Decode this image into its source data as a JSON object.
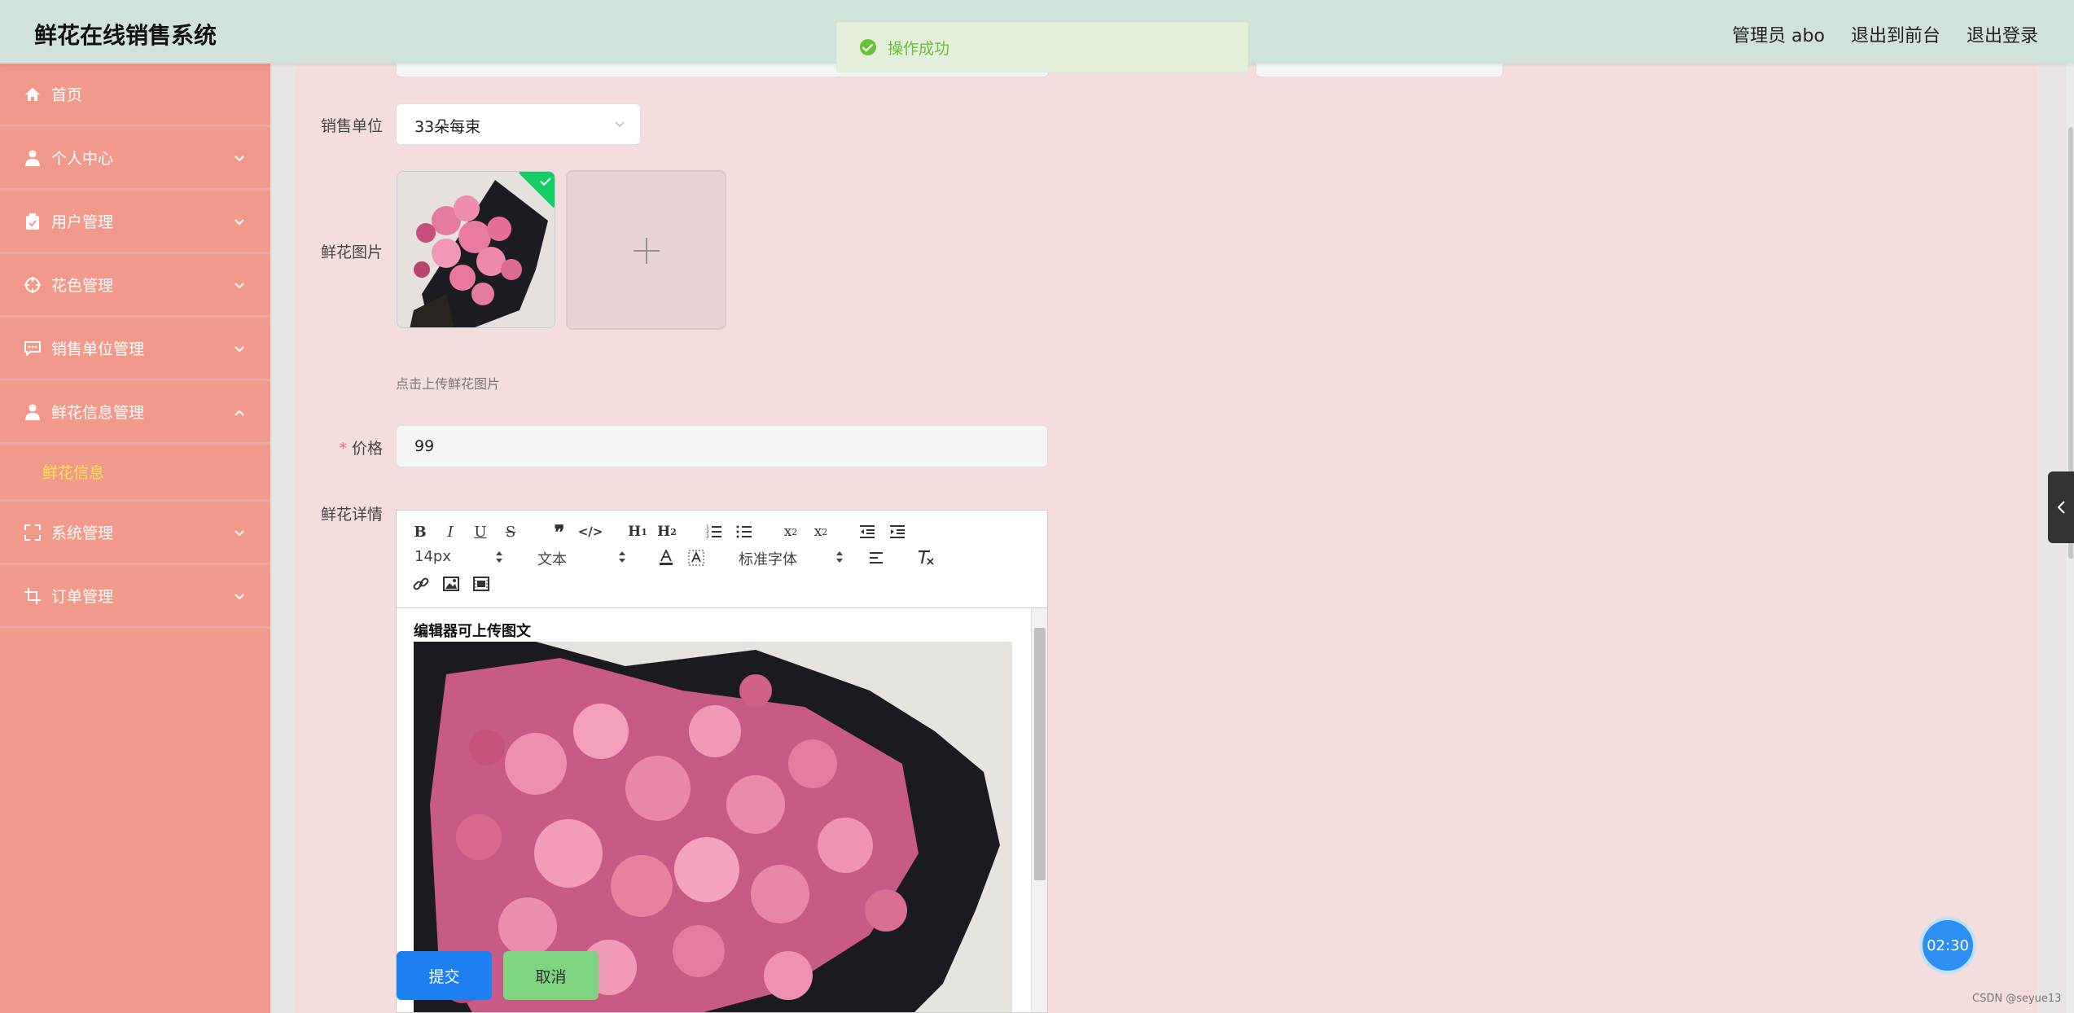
{
  "header": {
    "title": "鲜花在线销售系统",
    "admin": "管理员 abo",
    "to_front": "退出到前台",
    "logout": "退出登录"
  },
  "toast": {
    "message": "操作成功",
    "icon": "success-check-icon",
    "color": "#67c23a"
  },
  "sidebar": {
    "items": [
      {
        "label": "首页",
        "icon": "home-icon"
      },
      {
        "label": "个人中心",
        "icon": "user-icon"
      },
      {
        "label": "用户管理",
        "icon": "clipboard-icon"
      },
      {
        "label": "花色管理",
        "icon": "target-icon"
      },
      {
        "label": "销售单位管理",
        "icon": "chat-icon"
      },
      {
        "label": "鲜花信息管理",
        "icon": "user-icon",
        "expanded": true
      },
      {
        "label": "鲜花信息",
        "sub": true,
        "active_color": "#f7e34e"
      },
      {
        "label": "系统管理",
        "icon": "fullscreen-icon"
      },
      {
        "label": "订单管理",
        "icon": "crop-icon"
      }
    ]
  },
  "form": {
    "unit_label": "销售单位",
    "unit_value": "33朵每束",
    "image_label": "鲜花图片",
    "upload_tip": "点击上传鲜花图片",
    "price_label": "价格",
    "price_value": "99",
    "detail_label": "鲜花详情"
  },
  "editor": {
    "font_size": "14px",
    "block_format": "文本",
    "font_family": "标准字体",
    "content_caption": "编辑器可上传图文"
  },
  "buttons": {
    "submit": "提交",
    "cancel": "取消"
  },
  "timer": "02:30",
  "watermark": "CSDN @seyue13",
  "colors": {
    "header_bg": "#d1e2d8",
    "sidebar_bg": "#f19a8b",
    "content_bg": "#f4dedd",
    "submit": "#1e7ff0",
    "cancel": "#7ed47f"
  }
}
